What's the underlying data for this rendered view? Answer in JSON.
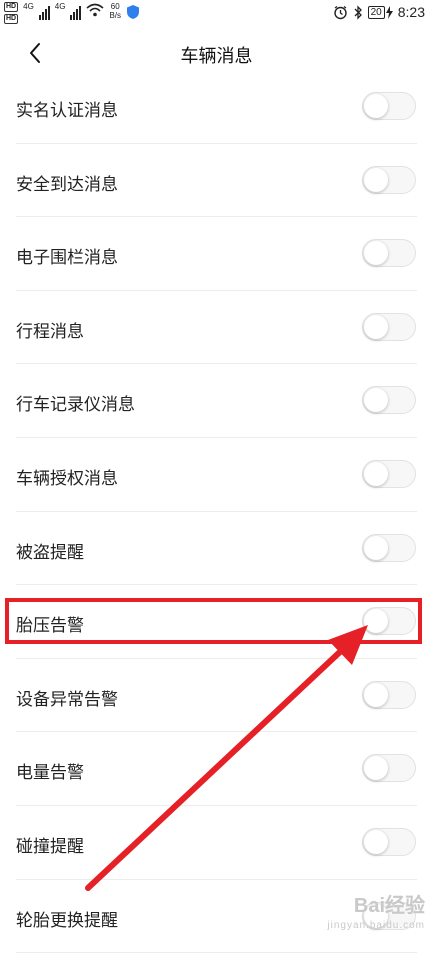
{
  "status_bar": {
    "hd1": "HD",
    "hd2": "HD",
    "net1": "4G",
    "net2": "4G",
    "speed_value": "60",
    "speed_unit": "B/s",
    "battery": "20",
    "time": "8:23",
    "icons": [
      "hd-icon",
      "signal-icon",
      "wifi-icon",
      "shield-icon",
      "alarm-icon",
      "bluetooth-icon",
      "battery-icon",
      "charging-icon"
    ]
  },
  "header": {
    "title": "车辆消息",
    "back_icon": "chevron-left-icon"
  },
  "settings": [
    {
      "label": "实名认证消息",
      "enabled": false
    },
    {
      "label": "安全到达消息",
      "enabled": false
    },
    {
      "label": "电子围栏消息",
      "enabled": false
    },
    {
      "label": "行程消息",
      "enabled": false
    },
    {
      "label": "行车记录仪消息",
      "enabled": false
    },
    {
      "label": "车辆授权消息",
      "enabled": false
    },
    {
      "label": "被盗提醒",
      "enabled": false
    },
    {
      "label": "胎压告警",
      "enabled": false
    },
    {
      "label": "设备异常告警",
      "enabled": false
    },
    {
      "label": "电量告警",
      "enabled": false
    },
    {
      "label": "碰撞提醒",
      "enabled": false
    },
    {
      "label": "轮胎更换提醒",
      "enabled": false
    }
  ],
  "annotation": {
    "highlight_color": "#e52026",
    "arrow_color": "#e52026",
    "highlighted_item": "胎压告警"
  },
  "watermark": {
    "text": "Bai经验",
    "sub": "jingyan.baidu.com"
  },
  "colors": {
    "toggle_off_bg": "#f7f7f7",
    "divider": "#ececec",
    "text": "#222222"
  }
}
